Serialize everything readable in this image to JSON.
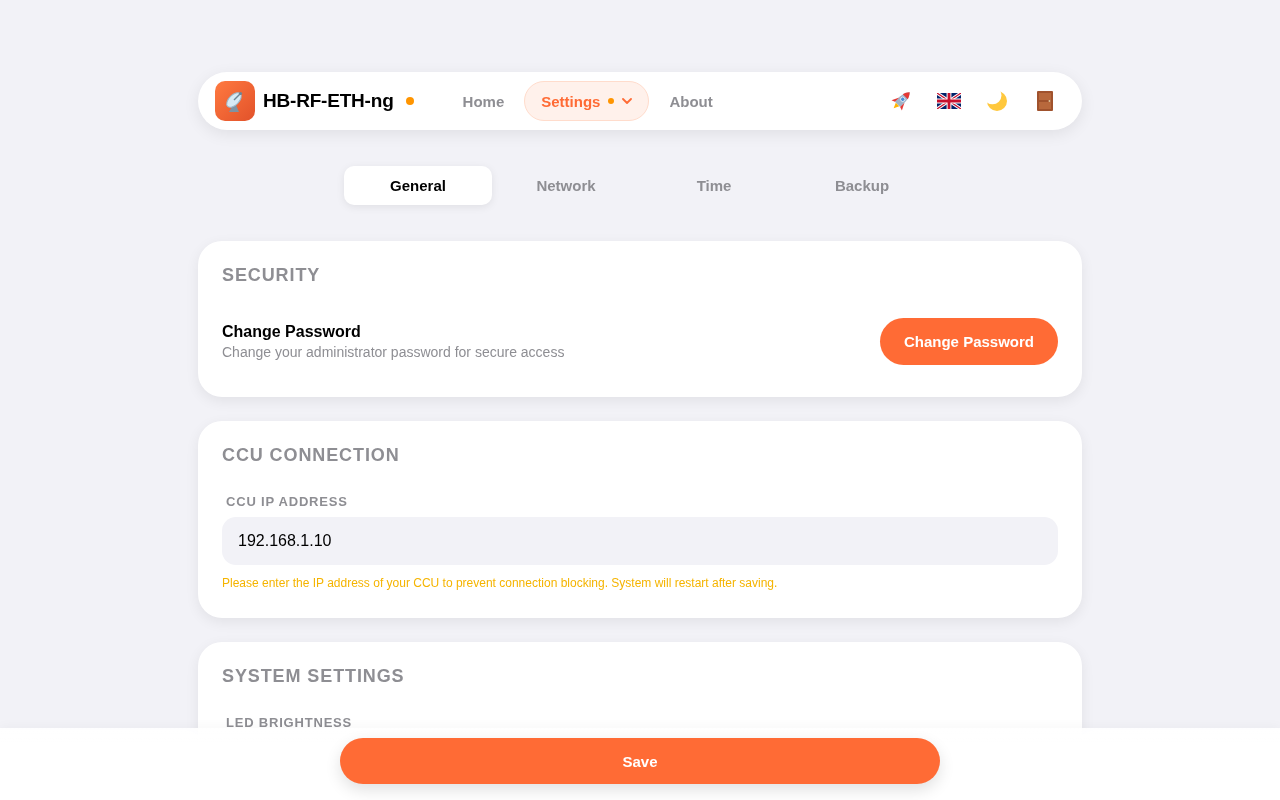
{
  "header": {
    "title": "HB-RF-ETH-ng",
    "status_indicator": true
  },
  "nav": [
    {
      "label": "Home",
      "kind": "link",
      "selected": false,
      "indicator": false
    },
    {
      "label": "Settings",
      "kind": "menu",
      "selected": true,
      "indicator": true
    },
    {
      "label": "About",
      "kind": "link",
      "selected": false,
      "indicator": false
    }
  ],
  "tabs": [
    {
      "label": "General",
      "selected": true
    },
    {
      "label": "Network",
      "selected": false
    },
    {
      "label": "Time",
      "selected": false
    },
    {
      "label": "Backup",
      "selected": false
    }
  ],
  "sections": [
    {
      "title": "SECURITY",
      "items": [
        {
          "kind": "action",
          "title": "Change Password",
          "description": "Change your administrator password for secure access",
          "button": "Change Password"
        }
      ]
    },
    {
      "title": "CCU CONNECTION",
      "items": [
        {
          "kind": "field",
          "label": "CCU IP ADDRESS",
          "value": "192.168.1.10",
          "hint": "Please enter the IP address of your CCU to prevent connection blocking. System will restart after saving."
        }
      ]
    },
    {
      "title": "SYSTEM SETTINGS",
      "items": [
        {
          "kind": "label",
          "label": "LED BRIGHTNESS"
        }
      ]
    }
  ],
  "footer": {
    "save_button": "Save"
  }
}
